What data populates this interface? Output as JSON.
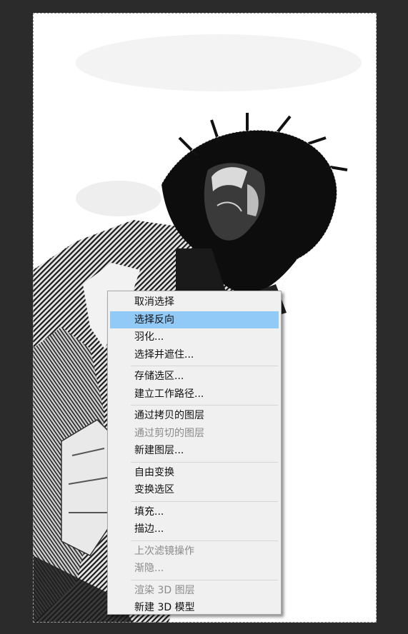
{
  "workspace": {
    "background": "#2b2b2b"
  },
  "context_menu": {
    "selected_color": "#91c9f7",
    "groups": [
      [
        {
          "label": "取消选择",
          "enabled": true,
          "selected": false
        },
        {
          "label": "选择反向",
          "enabled": true,
          "selected": true
        },
        {
          "label": "羽化...",
          "enabled": true,
          "selected": false
        },
        {
          "label": "选择并遮住...",
          "enabled": true,
          "selected": false
        }
      ],
      [
        {
          "label": "存储选区...",
          "enabled": true,
          "selected": false
        },
        {
          "label": "建立工作路径...",
          "enabled": true,
          "selected": false
        }
      ],
      [
        {
          "label": "通过拷贝的图层",
          "enabled": true,
          "selected": false
        },
        {
          "label": "通过剪切的图层",
          "enabled": false,
          "selected": false
        },
        {
          "label": "新建图层...",
          "enabled": true,
          "selected": false
        }
      ],
      [
        {
          "label": "自由变换",
          "enabled": true,
          "selected": false
        },
        {
          "label": "变换选区",
          "enabled": true,
          "selected": false
        }
      ],
      [
        {
          "label": "填充...",
          "enabled": true,
          "selected": false
        },
        {
          "label": "描边...",
          "enabled": true,
          "selected": false
        }
      ],
      [
        {
          "label": "上次滤镜操作",
          "enabled": false,
          "selected": false
        },
        {
          "label": "渐隐...",
          "enabled": false,
          "selected": false
        }
      ],
      [
        {
          "label": "渲染 3D 图层",
          "enabled": false,
          "selected": false
        },
        {
          "label": "新建 3D 模型",
          "enabled": true,
          "selected": false
        }
      ]
    ]
  }
}
